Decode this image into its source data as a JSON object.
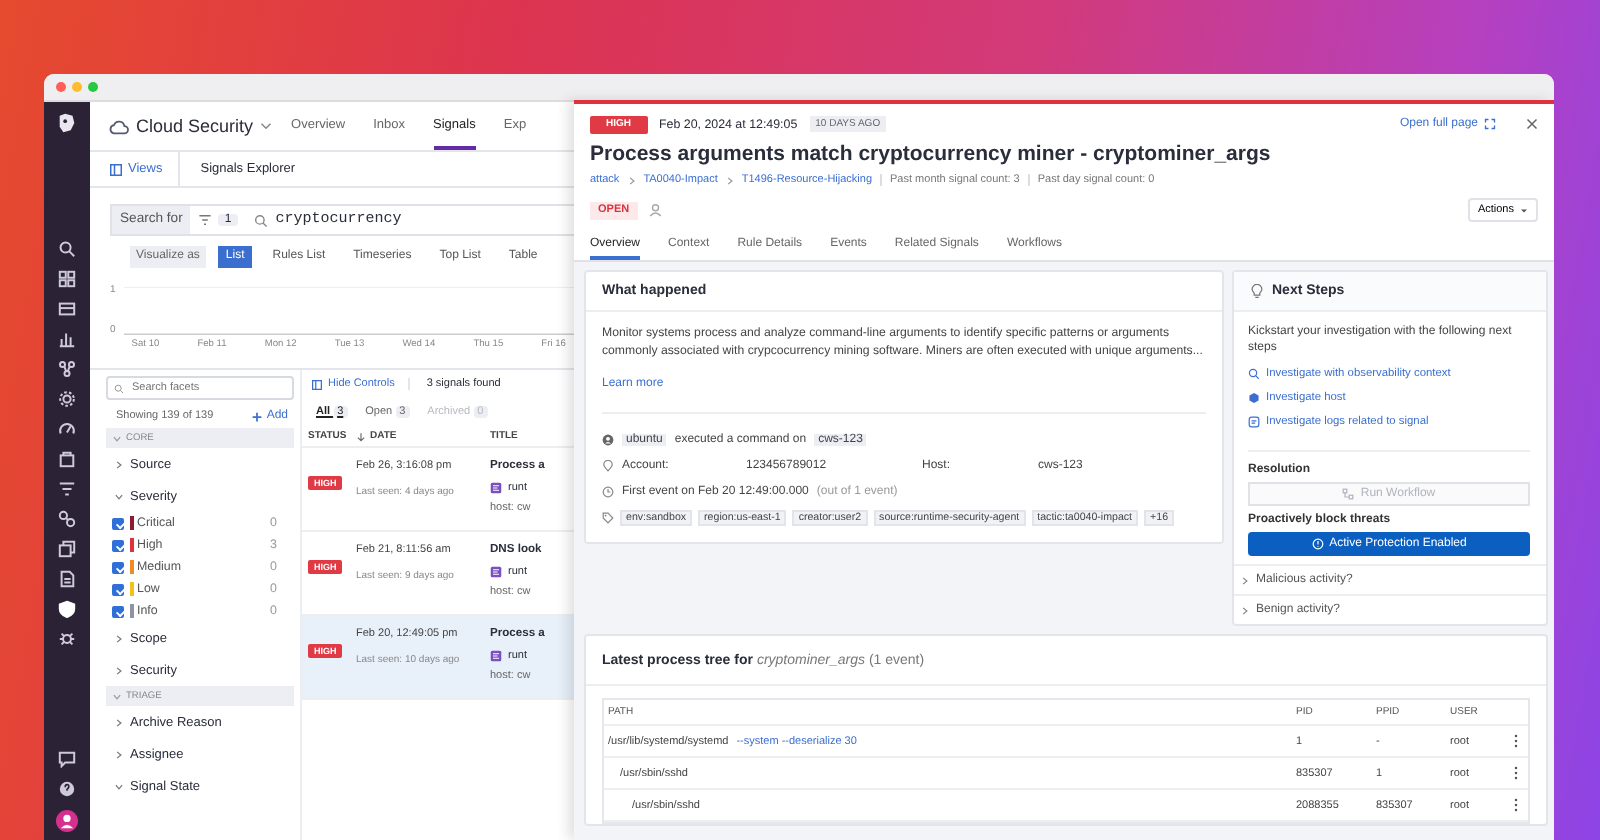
{
  "app_bar": {
    "product": "Cloud Security",
    "tabs": [
      {
        "label": "Overview",
        "selected": false
      },
      {
        "label": "Inbox",
        "selected": false
      },
      {
        "label": "Signals",
        "selected": true
      },
      {
        "label": "Exp",
        "selected": false
      }
    ]
  },
  "explorer": {
    "views_button": "Views",
    "title": "Signals Explorer",
    "search_label": "Search for",
    "filter_count": "1",
    "query": "cryptocurrency",
    "visualize_label": "Visualize as",
    "visualize_options": [
      {
        "label": "List",
        "selected": true
      },
      {
        "label": "Rules List",
        "selected": false
      },
      {
        "label": "Timeseries",
        "selected": false
      },
      {
        "label": "Top List",
        "selected": false
      },
      {
        "label": "Table",
        "selected": false
      }
    ],
    "timeline": {
      "y_labels": [
        "1",
        "0"
      ],
      "x_labels": [
        "Sat 10",
        "Feb 11",
        "Mon 12",
        "Tue 13",
        "Wed 14",
        "Thu 15",
        "Fri 16"
      ]
    }
  },
  "facets": {
    "search_placeholder": "Search facets",
    "showing": "Showing 139 of 139",
    "add": "Add",
    "groups": [
      {
        "kind": "section",
        "label": "CORE",
        "expanded": true
      },
      {
        "kind": "facet",
        "label": "Source",
        "expanded": false
      },
      {
        "kind": "facet",
        "label": "Severity",
        "expanded": true,
        "options": [
          {
            "label": "Critical",
            "count": "0",
            "checked": true,
            "color": "#8e1b32"
          },
          {
            "label": "High",
            "count": "3",
            "checked": true,
            "color": "#e0323c"
          },
          {
            "label": "Medium",
            "count": "0",
            "checked": true,
            "color": "#f08a24"
          },
          {
            "label": "Low",
            "count": "0",
            "checked": true,
            "color": "#f2c21b"
          },
          {
            "label": "Info",
            "count": "0",
            "checked": true,
            "color": "#8e93a6"
          }
        ]
      },
      {
        "kind": "facet",
        "label": "Scope",
        "expanded": false
      },
      {
        "kind": "facet",
        "label": "Security",
        "expanded": false
      },
      {
        "kind": "section",
        "label": "TRIAGE",
        "expanded": true
      },
      {
        "kind": "facet",
        "label": "Archive Reason",
        "expanded": false
      },
      {
        "kind": "facet",
        "label": "Assignee",
        "expanded": false
      },
      {
        "kind": "facet",
        "label": "Signal State",
        "expanded": true
      }
    ]
  },
  "signals": {
    "hide_controls": "Hide Controls",
    "found": "3 signals found",
    "tabs": [
      {
        "label": "All",
        "count": "3",
        "selected": true,
        "disabled": false
      },
      {
        "label": "Open",
        "count": "3",
        "selected": false,
        "disabled": false
      },
      {
        "label": "Archived",
        "count": "0",
        "selected": false,
        "disabled": true
      }
    ],
    "columns": [
      "STATUS",
      "DATE",
      "TITLE"
    ],
    "rows": [
      {
        "severity": "HIGH",
        "date": "Feb 26, 3:16:08 pm",
        "last_seen": "Last seen: 4 days ago",
        "title": "Process a",
        "source": "runt",
        "host": "host: cw",
        "selected": false
      },
      {
        "severity": "HIGH",
        "date": "Feb 21, 8:11:56 am",
        "last_seen": "Last seen: 9 days ago",
        "title": "DNS look",
        "source": "runt",
        "host": "host: cw",
        "selected": false
      },
      {
        "severity": "HIGH",
        "date": "Feb 20, 12:49:05 pm",
        "last_seen": "Last seen: 10 days ago",
        "title": "Process a",
        "source": "runt",
        "host": "host: cw",
        "selected": true
      }
    ]
  },
  "signal_panel": {
    "severity": "HIGH",
    "timestamp": "Feb 20, 2024 at 12:49:05",
    "age": "10 DAYS AGO",
    "open_full_page": "Open full page",
    "title": "Process arguments match cryptocurrency miner - cryptominer_args",
    "breadcrumb": [
      "attack",
      "TA0040-Impact",
      "T1496-Resource-Hijacking"
    ],
    "counts": [
      "Past month signal count: 3",
      "Past day signal count: 0"
    ],
    "status": "OPEN",
    "actions": "Actions",
    "tabs": [
      {
        "label": "Overview",
        "selected": true
      },
      {
        "label": "Context",
        "selected": false
      },
      {
        "label": "Rule Details",
        "selected": false
      },
      {
        "label": "Events",
        "selected": false
      },
      {
        "label": "Related Signals",
        "selected": false
      },
      {
        "label": "Workflows",
        "selected": false
      }
    ]
  },
  "what_happened": {
    "heading": "What happened",
    "description": "Monitor systems process and analyze command-line arguments to identify specific patterns or arguments commonly associated with crypcocurrency mining software. Miners are often executed with unique arguments...",
    "learn_more": "Learn more",
    "actor": "ubuntu",
    "action": "executed a command on",
    "target": "cws-123",
    "fields": [
      {
        "label": "Account:",
        "value": "123456789012"
      },
      {
        "label": "Host:",
        "value": "cws-123"
      }
    ],
    "first_event": "First event on Feb 20 12:49:00.000",
    "event_count": "(out of 1 event)",
    "tags": [
      "env:sandbox",
      "region:us-east-1",
      "creator:user2",
      "source:runtime-security-agent",
      "tactic:ta0040-impact"
    ],
    "more_tags": "+16"
  },
  "next_steps": {
    "heading": "Next Steps",
    "intro": "Kickstart your investigation with the following next steps",
    "links": [
      {
        "kind": "search",
        "label": "Investigate with observability context"
      },
      {
        "kind": "host",
        "label": "Investigate host"
      },
      {
        "kind": "logs",
        "label": "Investigate logs related to signal"
      }
    ],
    "resolution_label": "Resolution",
    "run_workflow": {
      "label": "Run Workflow",
      "disabled": true
    },
    "block_label": "Proactively block threats",
    "protection_button": "Active Protection Enabled",
    "questions": [
      {
        "label": "Malicious activity?",
        "expanded": false
      },
      {
        "label": "Benign activity?",
        "expanded": false
      }
    ]
  },
  "process_tree": {
    "heading": "**Latest process tree for** *cryptominer_args* (1 event)",
    "columns": [
      "PATH",
      "PID",
      "PPID",
      "USER"
    ],
    "rows": [
      {
        "path": "/usr/lib/systemd/systemd",
        "args": "--system --deserialize 30",
        "pid": "1",
        "ppid": "-",
        "user": "root",
        "children": [
          {
            "path": "/usr/sbin/sshd",
            "pid": "835307",
            "ppid": "1",
            "user": "root",
            "children": [
              {
                "path": "/usr/sbin/sshd",
                "pid": "2088355",
                "ppid": "835307",
                "user": "root"
              }
            ]
          }
        ]
      }
    ]
  }
}
